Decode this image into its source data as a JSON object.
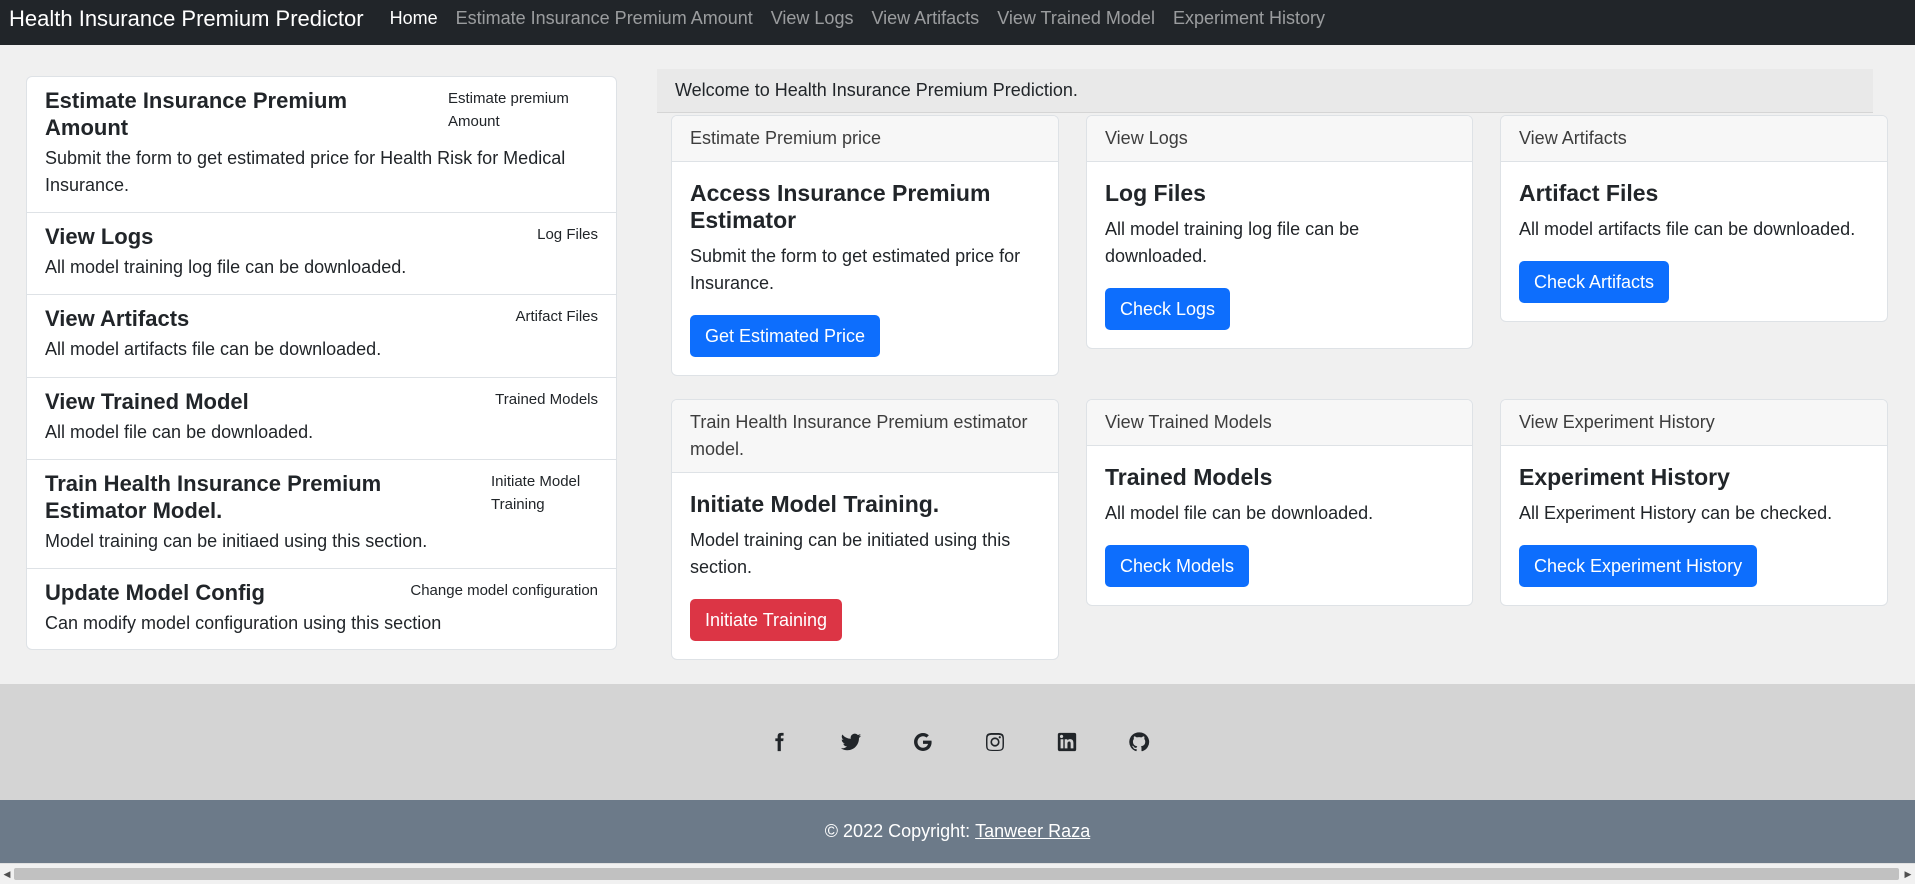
{
  "navbar": {
    "brand": "Health Insurance Premium Predictor",
    "links": [
      {
        "label": "Home",
        "active": true
      },
      {
        "label": "Estimate Insurance Premium Amount",
        "active": false
      },
      {
        "label": "View Logs",
        "active": false
      },
      {
        "label": "View Artifacts",
        "active": false
      },
      {
        "label": "View Trained Model",
        "active": false
      },
      {
        "label": "Experiment History",
        "active": false
      }
    ]
  },
  "sidebar": {
    "items": [
      {
        "title": "Estimate Insurance Premium Amount",
        "small": "Estimate premium Amount",
        "desc": "Submit the form to get estimated price for Health Risk for Medical Insurance."
      },
      {
        "title": "View Logs",
        "small": "Log Files",
        "desc": "All model training log file can be downloaded."
      },
      {
        "title": "View Artifacts",
        "small": "Artifact Files",
        "desc": "All model artifacts file can be downloaded."
      },
      {
        "title": "View Trained Model",
        "small": "Trained Models",
        "desc": "All model file can be downloaded."
      },
      {
        "title": "Train Health Insurance Premium Estimator Model.",
        "small": "Initiate Model Training",
        "desc": "Model training can be initiaed using this section."
      },
      {
        "title": "Update Model Config",
        "small": "Change model configuration",
        "desc": "Can modify model configuration using this section"
      }
    ]
  },
  "welcome": "Welcome to Health Insurance Premium Prediction.",
  "cards": [
    {
      "header": "Estimate Premium price",
      "title": "Access Insurance Premium Estimator",
      "text": "Submit the form to get estimated price for Insurance.",
      "button": "Get Estimated Price",
      "button_color": "#0d6efd"
    },
    {
      "header": "View Logs",
      "title": "Log Files",
      "text": "All model training log file can be downloaded.",
      "button": "Check Logs",
      "button_color": "#0d6efd"
    },
    {
      "header": "View Artifacts",
      "title": "Artifact Files",
      "text": "All model artifacts file can be downloaded.",
      "button": "Check Artifacts",
      "button_color": "#0d6efd"
    },
    {
      "header": "Train Health Insurance Premium estimator model.",
      "title": "Initiate Model Training.",
      "text": "Model training can be initiated using this section.",
      "button": "Initiate Training",
      "button_color": "#dc3545"
    },
    {
      "header": "View Trained Models",
      "title": "Trained Models",
      "text": "All model file can be downloaded.",
      "button": "Check Models",
      "button_color": "#0d6efd"
    },
    {
      "header": "View Experiment History",
      "title": "Experiment History",
      "text": "All Experiment History can be checked.",
      "button": "Check Experiment History",
      "button_color": "#0d6efd"
    }
  ],
  "footer": {
    "social_icons": [
      "facebook-icon",
      "twitter-icon",
      "google-icon",
      "instagram-icon",
      "linkedin-icon",
      "github-icon"
    ],
    "copyright_prefix": "© 2022 Copyright:",
    "author": "Tanweer Raza"
  },
  "colors": {
    "navbar_bg": "#212529",
    "primary": "#0d6efd",
    "danger": "#dc3545",
    "social_bar_bg": "#d4d4d4",
    "copyright_bg": "#6c7a89"
  }
}
